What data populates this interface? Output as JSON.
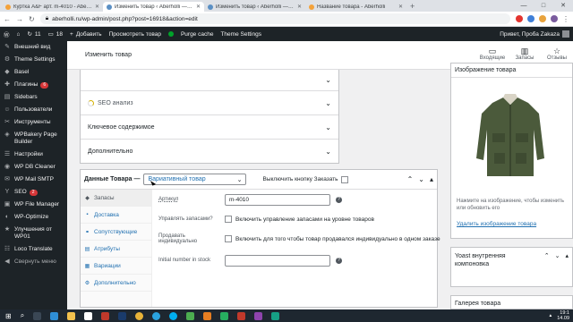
{
  "browser": {
    "tabs": [
      {
        "title": "Куртка A&F арт. m-4010 - Aberholli",
        "active": false,
        "color": "#f4a23b"
      },
      {
        "title": "Изменить товар ‹ Aberholli — Wo",
        "active": true,
        "color": "#5a8fc4"
      },
      {
        "title": "Изменить товар ‹ Aberholli — Wo",
        "active": false,
        "color": "#5a8fc4"
      },
      {
        "title": "Название товара - Aberholli",
        "active": false,
        "color": "#f4a23b"
      }
    ],
    "new_tab": "+",
    "url": "aberholli.ru/wp-admin/post.php?post=16918&action=edit",
    "minimize": "—",
    "maximize": "□",
    "close": "✕"
  },
  "adminbar": {
    "updates_count": "11",
    "comments_count": "18",
    "add_new": "Добавить",
    "view_product": "Просмотреть товар",
    "purge_cache": "Purge cache",
    "theme_settings": "Theme Settings",
    "greeting": "Привет, Проба Zakaza"
  },
  "sidebar": {
    "items": [
      {
        "label": "Внешний вид",
        "icon": "brush-icon",
        "glyph": "✎"
      },
      {
        "label": "Theme Settings",
        "icon": "settings-icon",
        "glyph": "⚙"
      },
      {
        "label": "Basel",
        "icon": "basel-icon",
        "glyph": "◆"
      },
      {
        "label": "Плагины",
        "icon": "plugins-icon",
        "glyph": "✚",
        "badge": "6"
      },
      {
        "label": "Sidebars",
        "icon": "sidebars-icon",
        "glyph": "▤"
      },
      {
        "label": "Пользователи",
        "icon": "users-icon",
        "glyph": "☺"
      },
      {
        "label": "Инструменты",
        "icon": "tools-icon",
        "glyph": "✂"
      },
      {
        "label": "WPBakery Page Builder",
        "icon": "wpbakery-icon",
        "glyph": "◈"
      },
      {
        "label": "Настройки",
        "icon": "settings-sliders-icon",
        "glyph": "☰"
      },
      {
        "label": "WP DB Cleaner",
        "icon": "db-cleaner-icon",
        "glyph": "◉"
      },
      {
        "label": "WP Mail SMTP",
        "icon": "mail-icon",
        "glyph": "✉"
      },
      {
        "label": "SEO",
        "icon": "yoast-icon",
        "glyph": "Y",
        "badge": "2"
      },
      {
        "label": "WP File Manager",
        "icon": "file-manager-icon",
        "glyph": "▣"
      },
      {
        "label": "WP-Optimize",
        "icon": "optimize-icon",
        "glyph": "◐"
      },
      {
        "label": "Улучшения от WP01",
        "icon": "wp01-icon",
        "glyph": "★"
      },
      {
        "label": "Loco Translate",
        "icon": "translate-icon",
        "glyph": "☷"
      },
      {
        "label": "Свернуть меню",
        "icon": "collapse-icon",
        "glyph": "◀"
      }
    ]
  },
  "page": {
    "title": "Изменить товар",
    "header_icons": [
      {
        "label": "Входящие",
        "glyph": "▭",
        "icon": "inbox-icon"
      },
      {
        "label": "Запасы",
        "glyph": "▥",
        "icon": "stock-icon"
      },
      {
        "label": "Отзывы",
        "glyph": "☆",
        "icon": "reviews-icon"
      }
    ]
  },
  "seo": {
    "rows": [
      {
        "label": "",
        "show_chevron": true
      },
      {
        "label": "SEO анализ",
        "loading": true
      },
      {
        "label": "Ключевое содержимое"
      },
      {
        "label": "Дополнительно"
      }
    ]
  },
  "product_data": {
    "label": "Данные Товара —",
    "type_value": "Вариативный товар",
    "disable_order_label": "Выключить кнопку Заказать",
    "tabs": [
      {
        "label": "Запасы",
        "glyph": "◆",
        "active": true
      },
      {
        "label": "Доставка",
        "glyph": "▪",
        "active": false
      },
      {
        "label": "Сопутствующие",
        "glyph": "⚭",
        "active": false
      },
      {
        "label": "Атрибуты",
        "glyph": "▤",
        "active": false
      },
      {
        "label": "Вариации",
        "glyph": "▦",
        "active": false
      },
      {
        "label": "Дополнительно",
        "glyph": "⚙",
        "active": false
      }
    ],
    "fields": {
      "sku_label": "Артикул",
      "sku_value": "m-4010",
      "manage_stock_label": "Управлять запасами?",
      "manage_stock_text": "Включить управление запасами на уровне товаров",
      "sold_individually_label": "Продавать индивидуально",
      "sold_individually_text": "Включить для того чтобы товар продавался индивидуально в одном заказе",
      "initial_stock_label": "Initial number in stock",
      "initial_stock_value": ""
    }
  },
  "product_image": {
    "title": "Изображение товара",
    "hint": "Нажмите на изображение, чтобы изменить или обновить его",
    "remove_link": "Удалить изображение товара"
  },
  "yoast_box": {
    "title": "Yoast внутренняя компоновка"
  },
  "gallery_box": {
    "title": "Галерея товара"
  },
  "taskbar": {
    "time": "19:1",
    "date": "14.09"
  }
}
